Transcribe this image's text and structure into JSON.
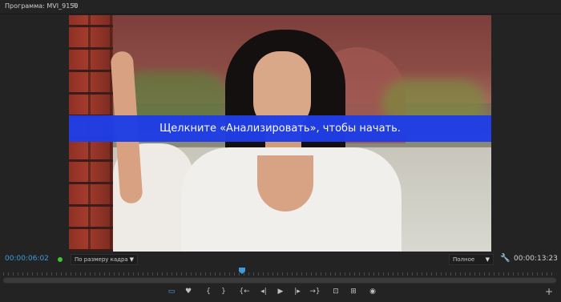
{
  "panel": {
    "title": "Программа: MVI_9150",
    "menu_icon": "≡"
  },
  "video": {
    "overlay_text": "Щелкните «Анализировать», чтобы начать."
  },
  "controls": {
    "current_time": "00:00:06:02",
    "fit_label": "По размеру кадра",
    "quality_label": "Полное",
    "duration": "00:00:13:23",
    "colors": {
      "accent": "#3d9bdc",
      "banner": "#1f3ee6",
      "status_dot": "#3cc33c"
    }
  },
  "toolbar": {
    "buttons": {
      "marker": "▭",
      "marker2": "♥",
      "in_point": "{",
      "out_point": "}",
      "go_to_in": "{←",
      "step_back": "◂|",
      "play": "▶",
      "step_forward": "|▸",
      "go_to_out": "→}",
      "insert": "⊡",
      "overwrite": "⊞",
      "export_frame": "◉",
      "add": "+"
    }
  }
}
